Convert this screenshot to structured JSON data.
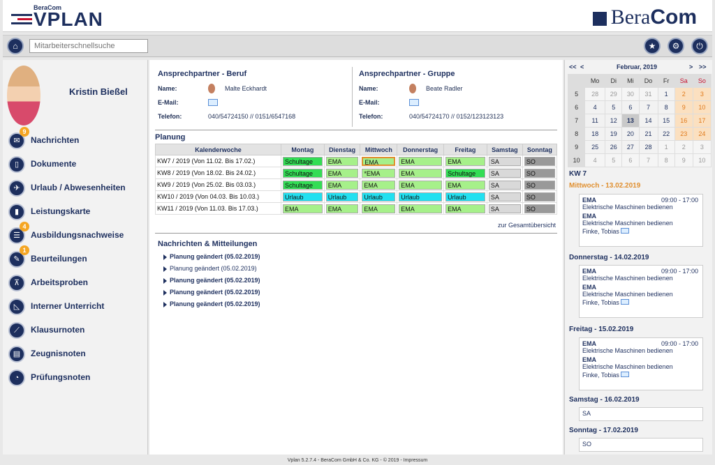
{
  "header": {
    "brand_small": "BeraCom",
    "brand": "VPLAN",
    "company_logo_a": "Bera",
    "company_logo_b": "Com"
  },
  "toolbar": {
    "search_placeholder": "Mitarbeiterschnellsuche"
  },
  "user": {
    "name": "Kristin Bießel"
  },
  "nav": [
    {
      "label": "Nachrichten",
      "icon": "mail-icon",
      "badge": "9"
    },
    {
      "label": "Dokumente",
      "icon": "document-icon",
      "badge": ""
    },
    {
      "label": "Urlaub / Abwesenheiten",
      "icon": "plane-icon",
      "badge": ""
    },
    {
      "label": "Leistungskarte",
      "icon": "bar-chart-icon",
      "badge": ""
    },
    {
      "label": "Ausbildungsnachweise",
      "icon": "list-icon",
      "badge": "4"
    },
    {
      "label": "Beurteilungen",
      "icon": "edit-icon",
      "badge": "1"
    },
    {
      "label": "Arbeitsproben",
      "icon": "compass-icon",
      "badge": ""
    },
    {
      "label": "Interner Unterricht",
      "icon": "triangle-ruler-icon",
      "badge": ""
    },
    {
      "label": "Klausurnoten",
      "icon": "graph-icon",
      "badge": ""
    },
    {
      "label": "Zeugnisnoten",
      "icon": "certificate-icon",
      "badge": ""
    },
    {
      "label": "Prüfungsnoten",
      "icon": "pie-chart-icon",
      "badge": ""
    }
  ],
  "contact_job": {
    "title": "Ansprechpartner - Beruf",
    "name_label": "Name:",
    "name": "Malte Eckhardt",
    "email_label": "E-Mail:",
    "phone_label": "Telefon:",
    "phone": "040/54724150 // 0151/6547168"
  },
  "contact_group": {
    "title": "Ansprechpartner - Gruppe",
    "name_label": "Name:",
    "name": "Beate Radler",
    "email_label": "E-Mail:",
    "phone_label": "Telefon:",
    "phone": "040/54724170 // 0152/123123123"
  },
  "planning": {
    "title": "Planung",
    "headers": [
      "Kalenderwoche",
      "Montag",
      "Dienstag",
      "Mittwoch",
      "Donnerstag",
      "Freitag",
      "Samstag",
      "Sonntag"
    ],
    "rows": [
      {
        "kw": "KW7 / 2019 (Von 11.02. Bis 17.02.)",
        "cells": [
          [
            "Schultage",
            "gd"
          ],
          [
            "EMA",
            "g"
          ],
          [
            "EMA",
            "sel"
          ],
          [
            "EMA",
            "g"
          ],
          [
            "EMA",
            "g"
          ],
          [
            "SA",
            "gy"
          ],
          [
            "SO",
            "dk"
          ]
        ]
      },
      {
        "kw": "KW8 / 2019 (Von 18.02. Bis 24.02.)",
        "cells": [
          [
            "Schultage",
            "gd"
          ],
          [
            "EMA",
            "g"
          ],
          [
            "*EMA",
            "g"
          ],
          [
            "EMA",
            "g"
          ],
          [
            "Schultage",
            "gd"
          ],
          [
            "SA",
            "gy"
          ],
          [
            "SO",
            "dk"
          ]
        ]
      },
      {
        "kw": "KW9 / 2019 (Von 25.02. Bis 03.03.)",
        "cells": [
          [
            "Schultage",
            "gd"
          ],
          [
            "EMA",
            "g"
          ],
          [
            "EMA",
            "g"
          ],
          [
            "EMA",
            "g"
          ],
          [
            "EMA",
            "g"
          ],
          [
            "SA",
            "gy"
          ],
          [
            "SO",
            "dk"
          ]
        ]
      },
      {
        "kw": "KW10 / 2019 (Von 04.03. Bis 10.03.)",
        "cells": [
          [
            "Urlaub",
            "c"
          ],
          [
            "Urlaub",
            "c"
          ],
          [
            "Urlaub",
            "c"
          ],
          [
            "Urlaub",
            "c"
          ],
          [
            "Urlaub",
            "c"
          ],
          [
            "SA",
            "gy"
          ],
          [
            "SO",
            "dk"
          ]
        ]
      },
      {
        "kw": "KW11 / 2019 (Von 11.03. Bis 17.03.)",
        "cells": [
          [
            "EMA",
            "g"
          ],
          [
            "EMA",
            "g"
          ],
          [
            "EMA",
            "g"
          ],
          [
            "EMA",
            "g"
          ],
          [
            "EMA",
            "g"
          ],
          [
            "SA",
            "gy"
          ],
          [
            "SO",
            "dk"
          ]
        ]
      }
    ],
    "overview_link": "zur Gesamtübersicht"
  },
  "messages": {
    "title": "Nachrichten & Mitteilungen",
    "items": [
      "Planung geändert (05.02.2019)",
      "Planung geändert (05.02.2019)",
      "Planung geändert (05.02.2019)",
      "Planung geändert (05.02.2019)",
      "Planung geändert (05.02.2019)"
    ]
  },
  "calendar": {
    "prev_year": "<<",
    "prev_month": "<",
    "month": "Februar, 2019",
    "next_month": ">",
    "next_year": ">>",
    "weekdays": [
      "Mo",
      "Di",
      "Mi",
      "Do",
      "Fr",
      "Sa",
      "So"
    ],
    "weeks": [
      {
        "wk": "5",
        "days": [
          "28",
          "29",
          "30",
          "31",
          "1",
          "2",
          "3"
        ]
      },
      {
        "wk": "6",
        "days": [
          "4",
          "5",
          "6",
          "7",
          "8",
          "9",
          "10"
        ]
      },
      {
        "wk": "7",
        "days": [
          "11",
          "12",
          "13",
          "14",
          "15",
          "16",
          "17"
        ]
      },
      {
        "wk": "8",
        "days": [
          "18",
          "19",
          "20",
          "21",
          "22",
          "23",
          "24"
        ]
      },
      {
        "wk": "9",
        "days": [
          "25",
          "26",
          "27",
          "28",
          "1",
          "2",
          "3"
        ]
      },
      {
        "wk": "10",
        "days": [
          "4",
          "5",
          "6",
          "7",
          "8",
          "9",
          "10"
        ]
      }
    ]
  },
  "schedule": {
    "week_label": "KW 7",
    "days": [
      {
        "title": "Mittwoch - 13.02.2019",
        "entries": [
          {
            "code": "EMA",
            "time": "09:00 - 17:00",
            "desc": "Elektrische Maschinen bedienen"
          },
          {
            "code": "EMA",
            "time": "",
            "desc": "Elektrische Maschinen bedienen"
          }
        ],
        "person": "Finke, Tobias"
      },
      {
        "title": "Donnerstag - 14.02.2019",
        "entries": [
          {
            "code": "EMA",
            "time": "09:00 - 17:00",
            "desc": "Elektrische Maschinen bedienen"
          },
          {
            "code": "EMA",
            "time": "",
            "desc": "Elektrische Maschinen bedienen"
          }
        ],
        "person": "Finke, Tobias"
      },
      {
        "title": "Freitag - 15.02.2019",
        "entries": [
          {
            "code": "EMA",
            "time": "09:00 - 17:00",
            "desc": "Elektrische Maschinen bedienen"
          },
          {
            "code": "EMA",
            "time": "",
            "desc": "Elektrische Maschinen bedienen"
          }
        ],
        "person": "Finke, Tobias"
      },
      {
        "title": "Samstag - 16.02.2019",
        "value": "SA"
      },
      {
        "title": "Sonntag - 17.02.2019",
        "value": "SO"
      }
    ]
  },
  "footer": "Vplan 5.2.7.4 - BeraCom GmbH & Co. KG - © 2019 - Impressum"
}
